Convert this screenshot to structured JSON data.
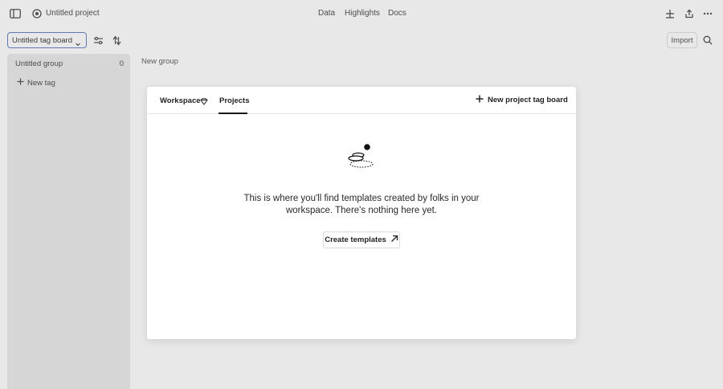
{
  "topbar": {
    "project_title": "Untitled project",
    "nav": [
      {
        "label": "Data"
      },
      {
        "label": "Highlights"
      },
      {
        "label": "Docs"
      }
    ]
  },
  "toolbar": {
    "board_select_value": "Untitled tag board",
    "import_label": "Import"
  },
  "board": {
    "column": {
      "title": "Untitled group",
      "count": "0",
      "new_tag_label": "New tag"
    },
    "new_group_label": "New group"
  },
  "modal": {
    "tabs": [
      {
        "label": "Workspace"
      },
      {
        "label": "Projects"
      }
    ],
    "active_tab": "Projects",
    "new_board_label": "New project tag board",
    "empty_message": "This is where you'll find templates created by folks in your workspace. There's nothing here yet.",
    "create_button_label": "Create templates"
  }
}
